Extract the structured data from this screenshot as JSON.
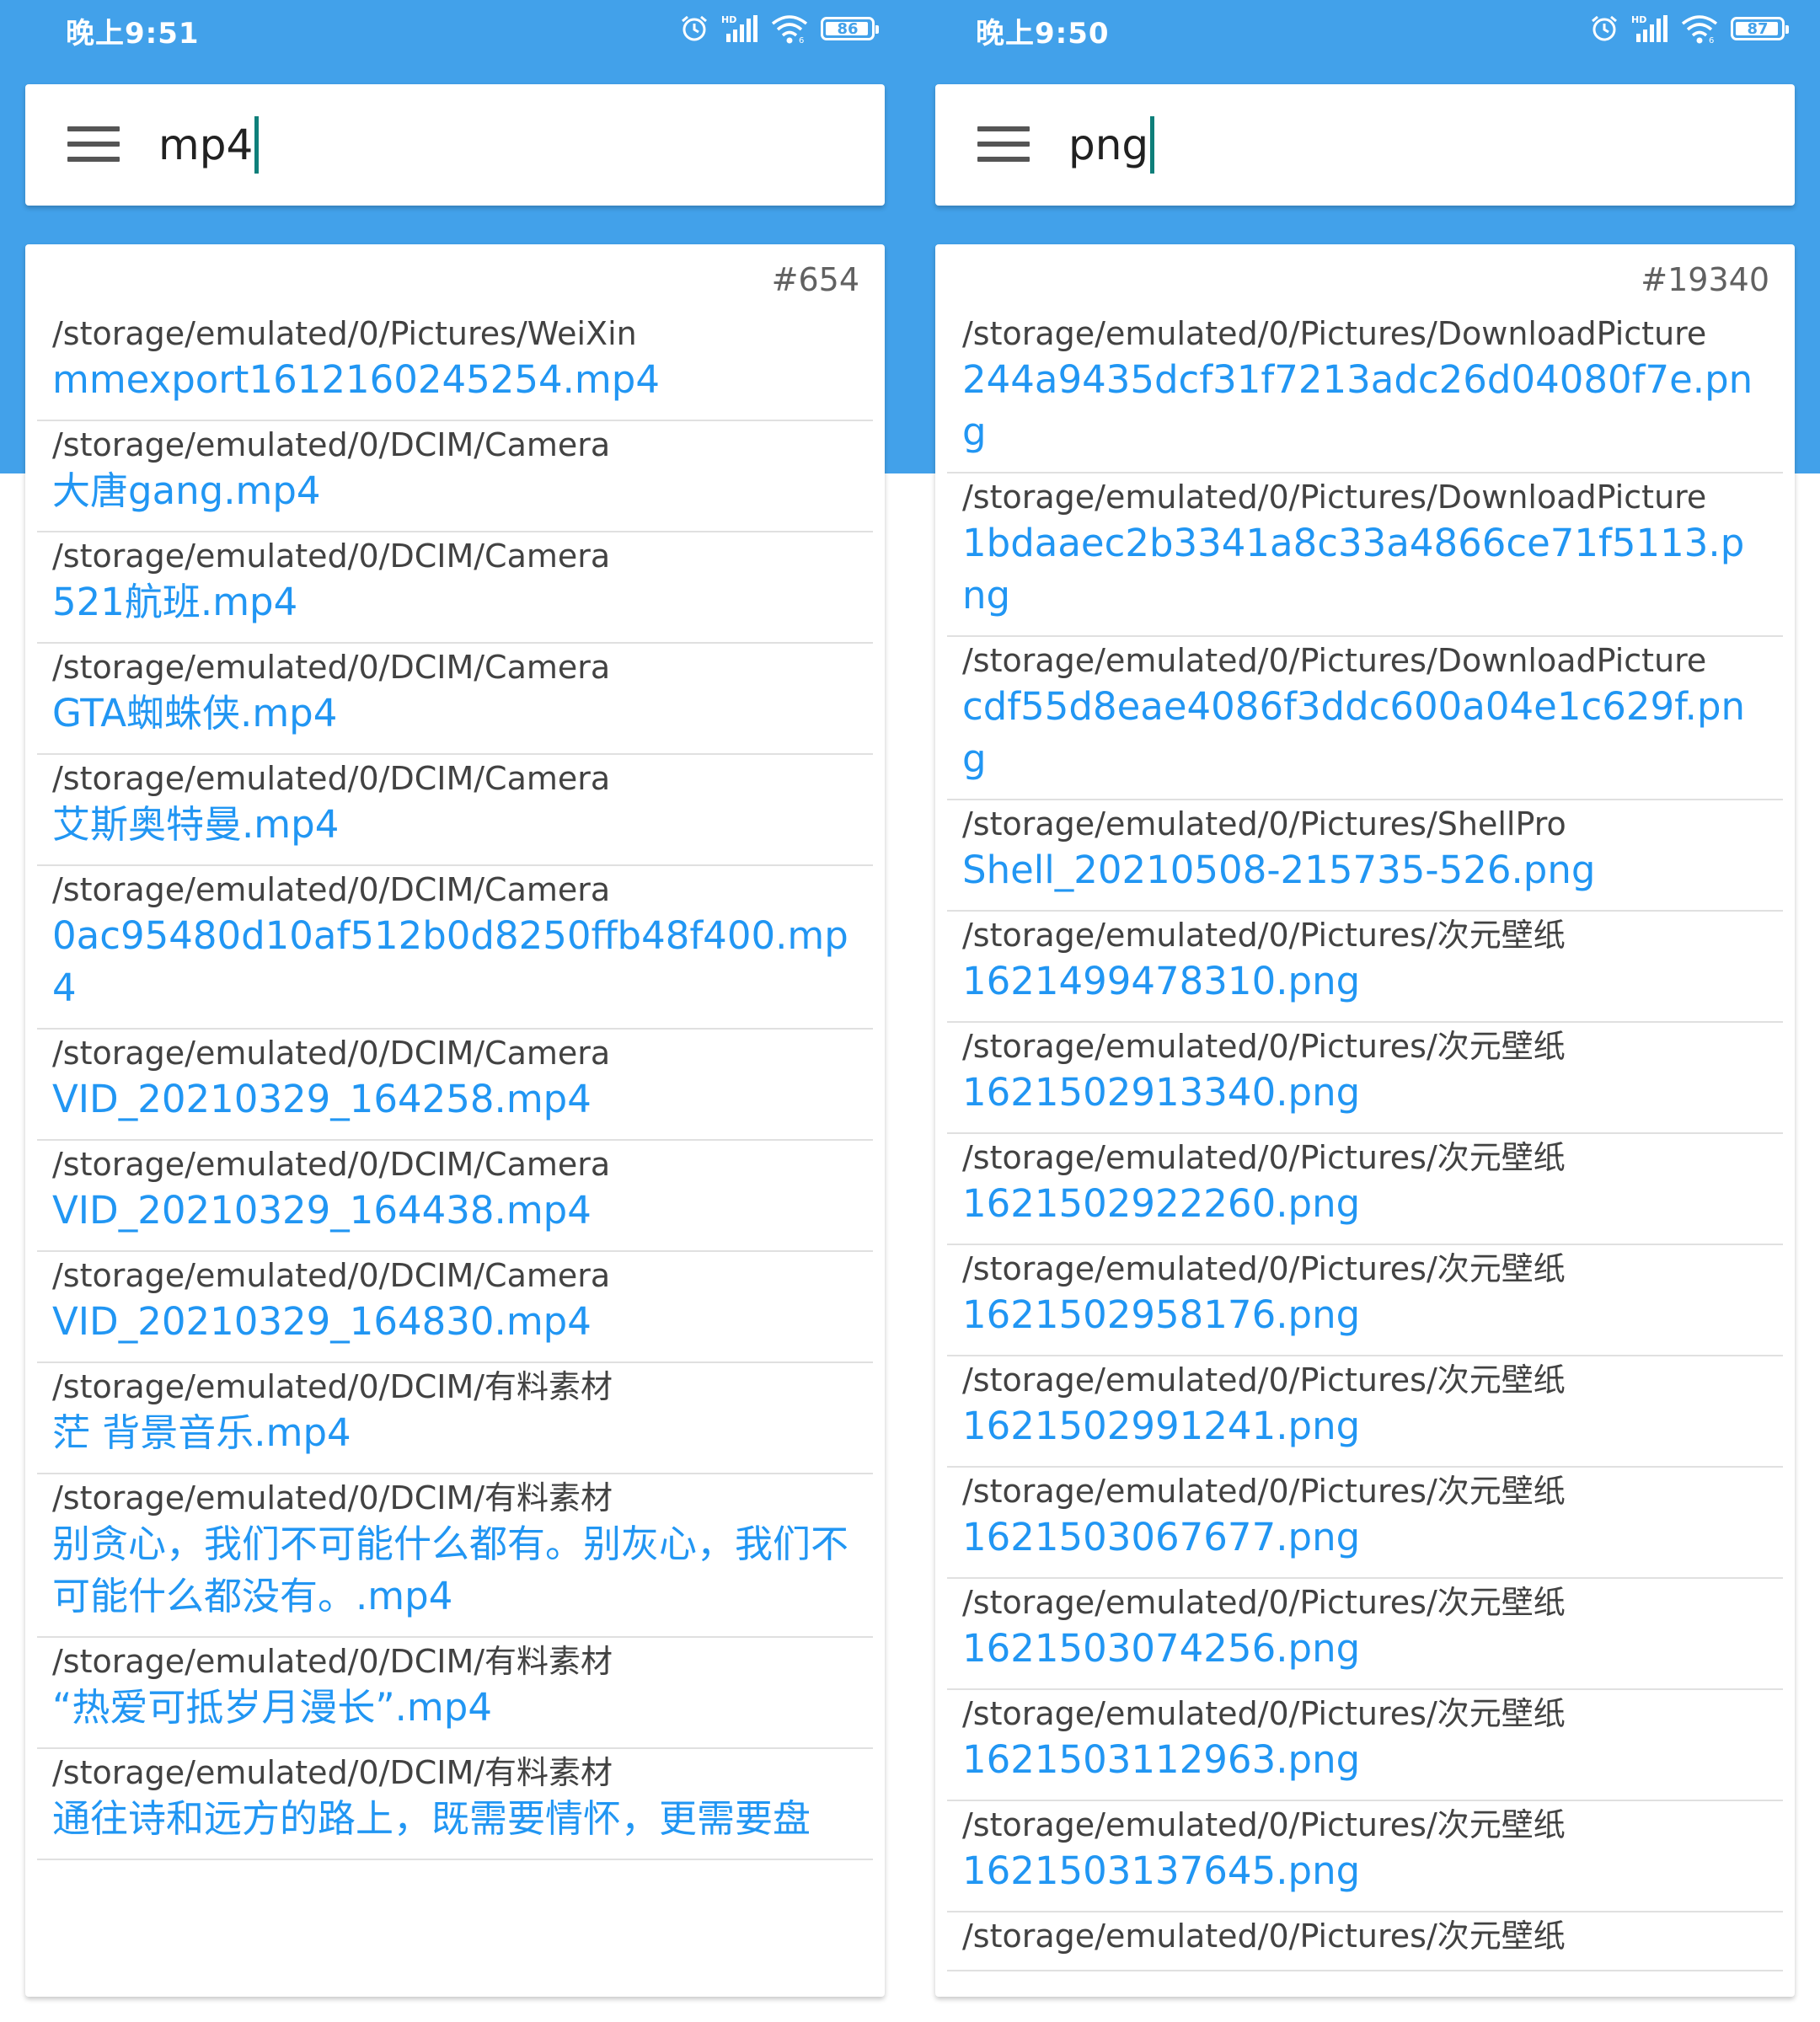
{
  "colors": {
    "accent": "#42a1ea",
    "link": "#2196f3",
    "path_text": "#424242",
    "caret": "#0f7f7a"
  },
  "left": {
    "status": {
      "time": "晚上9:51",
      "battery": "86",
      "icons": [
        "alarm-icon",
        "hd-signal-icon",
        "wifi-icon",
        "battery-icon"
      ]
    },
    "search": {
      "query": "mp4"
    },
    "results": {
      "count": "#654",
      "items": [
        {
          "path": "/storage/emulated/0/Pictures/WeiXin",
          "name": "mmexport1612160245254.mp4"
        },
        {
          "path": "/storage/emulated/0/DCIM/Camera",
          "name": "大唐gang.mp4"
        },
        {
          "path": "/storage/emulated/0/DCIM/Camera",
          "name": "521航班.mp4"
        },
        {
          "path": "/storage/emulated/0/DCIM/Camera",
          "name": "GTA蜘蛛侠.mp4"
        },
        {
          "path": "/storage/emulated/0/DCIM/Camera",
          "name": "艾斯奥特曼.mp4"
        },
        {
          "path": "/storage/emulated/0/DCIM/Camera",
          "name": "0ac95480d10af512b0d8250ffb48f400.mp4"
        },
        {
          "path": "/storage/emulated/0/DCIM/Camera",
          "name": "VID_20210329_164258.mp4"
        },
        {
          "path": "/storage/emulated/0/DCIM/Camera",
          "name": "VID_20210329_164438.mp4"
        },
        {
          "path": "/storage/emulated/0/DCIM/Camera",
          "name": "VID_20210329_164830.mp4"
        },
        {
          "path": "/storage/emulated/0/DCIM/有料素材",
          "name": "茫 背景音乐.mp4"
        },
        {
          "path": "/storage/emulated/0/DCIM/有料素材",
          "name": "别贪心，我们不可能什么都有。别灰心，我们不可能什么都没有。.mp4"
        },
        {
          "path": "/storage/emulated/0/DCIM/有料素材",
          "name": "“热爱可抵岁月漫长”.mp4"
        },
        {
          "path": "/storage/emulated/0/DCIM/有料素材",
          "name": "通往诗和远方的路上，既需要情怀，更需要盘"
        }
      ]
    }
  },
  "right": {
    "status": {
      "time": "晚上9:50",
      "battery": "87",
      "icons": [
        "alarm-icon",
        "hd-signal-icon",
        "wifi-icon",
        "battery-icon"
      ]
    },
    "search": {
      "query": "png"
    },
    "results": {
      "count": "#19340",
      "items": [
        {
          "path": "/storage/emulated/0/Pictures/DownloadPicture",
          "name": "244a9435dcf31f7213adc26d04080f7e.png"
        },
        {
          "path": "/storage/emulated/0/Pictures/DownloadPicture",
          "name": "1bdaaec2b3341a8c33a4866ce71f5113.png"
        },
        {
          "path": "/storage/emulated/0/Pictures/DownloadPicture",
          "name": "cdf55d8eae4086f3ddc600a04e1c629f.png"
        },
        {
          "path": "/storage/emulated/0/Pictures/ShellPro",
          "name": "Shell_20210508-215735-526.png"
        },
        {
          "path": "/storage/emulated/0/Pictures/次元壁纸",
          "name": "1621499478310.png"
        },
        {
          "path": "/storage/emulated/0/Pictures/次元壁纸",
          "name": "1621502913340.png"
        },
        {
          "path": "/storage/emulated/0/Pictures/次元壁纸",
          "name": "1621502922260.png"
        },
        {
          "path": "/storage/emulated/0/Pictures/次元壁纸",
          "name": "1621502958176.png"
        },
        {
          "path": "/storage/emulated/0/Pictures/次元壁纸",
          "name": "1621502991241.png"
        },
        {
          "path": "/storage/emulated/0/Pictures/次元壁纸",
          "name": "1621503067677.png"
        },
        {
          "path": "/storage/emulated/0/Pictures/次元壁纸",
          "name": "1621503074256.png"
        },
        {
          "path": "/storage/emulated/0/Pictures/次元壁纸",
          "name": "1621503112963.png"
        },
        {
          "path": "/storage/emulated/0/Pictures/次元壁纸",
          "name": "1621503137645.png"
        },
        {
          "path": "/storage/emulated/0/Pictures/次元壁纸",
          "name": ""
        }
      ]
    }
  }
}
